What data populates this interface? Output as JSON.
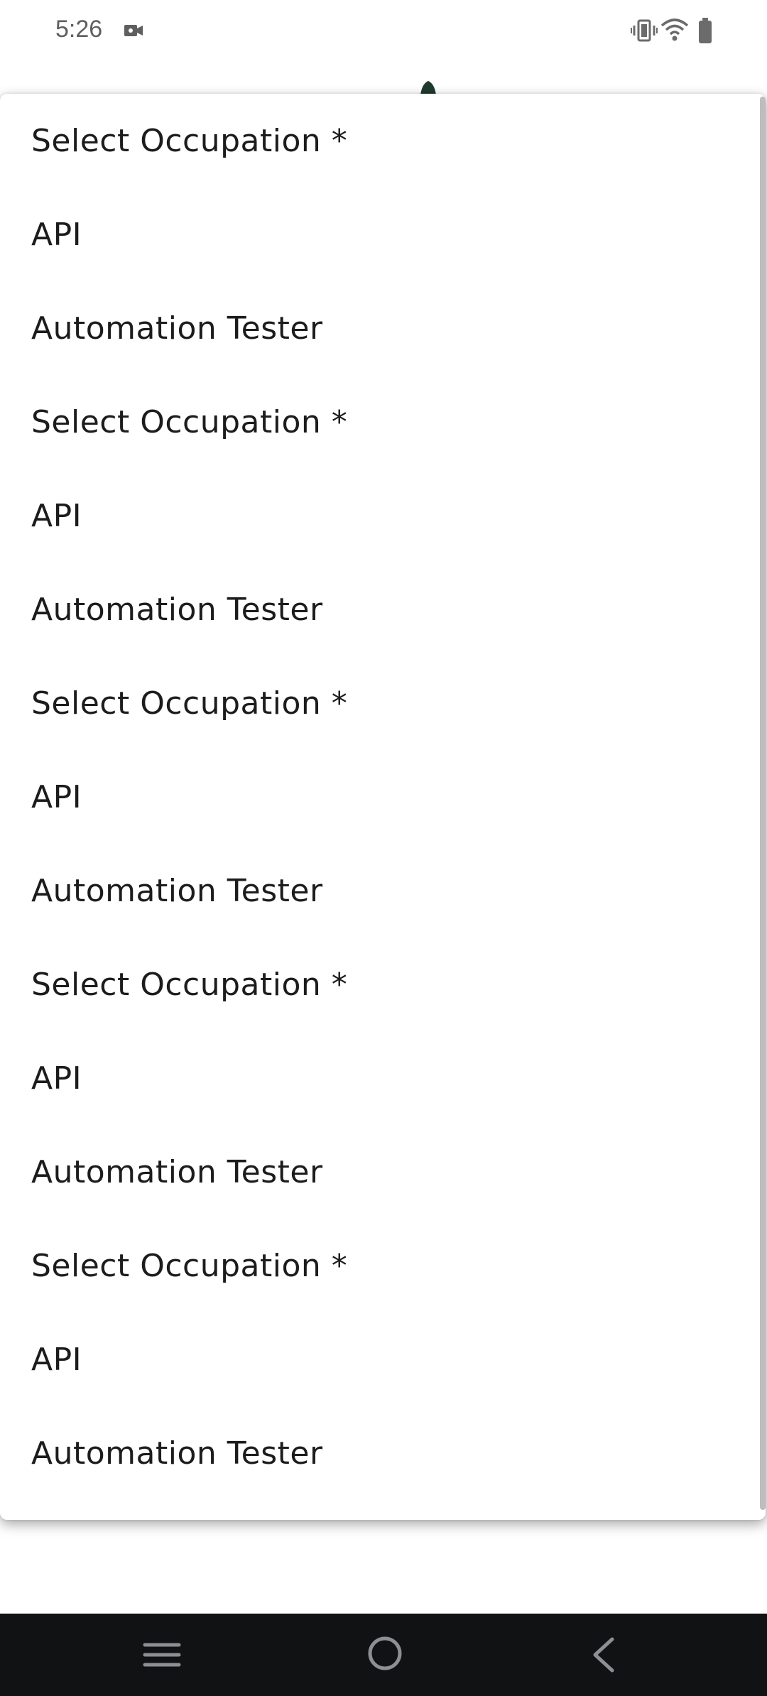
{
  "status_bar": {
    "time": "5:26",
    "icons": [
      "video-camera-icon",
      "vibrate-icon",
      "wifi-icon",
      "battery-icon"
    ]
  },
  "dropdown": {
    "options": [
      {
        "label": "Select Occupation *"
      },
      {
        "label": "API"
      },
      {
        "label": "Automation Tester"
      },
      {
        "label": "Select Occupation *"
      },
      {
        "label": "API"
      },
      {
        "label": "Automation Tester"
      },
      {
        "label": "Select Occupation *"
      },
      {
        "label": "API"
      },
      {
        "label": "Automation Tester"
      },
      {
        "label": "Select Occupation *"
      },
      {
        "label": "API"
      },
      {
        "label": "Automation Tester"
      },
      {
        "label": "Select Occupation *"
      },
      {
        "label": "API"
      },
      {
        "label": "Automation Tester"
      }
    ]
  },
  "nav_bar": {
    "buttons": [
      "recents-icon",
      "home-icon",
      "back-icon"
    ]
  },
  "colors": {
    "nav_background": "#111214",
    "menu_background": "#ffffff",
    "text": "#1c1c1c"
  }
}
